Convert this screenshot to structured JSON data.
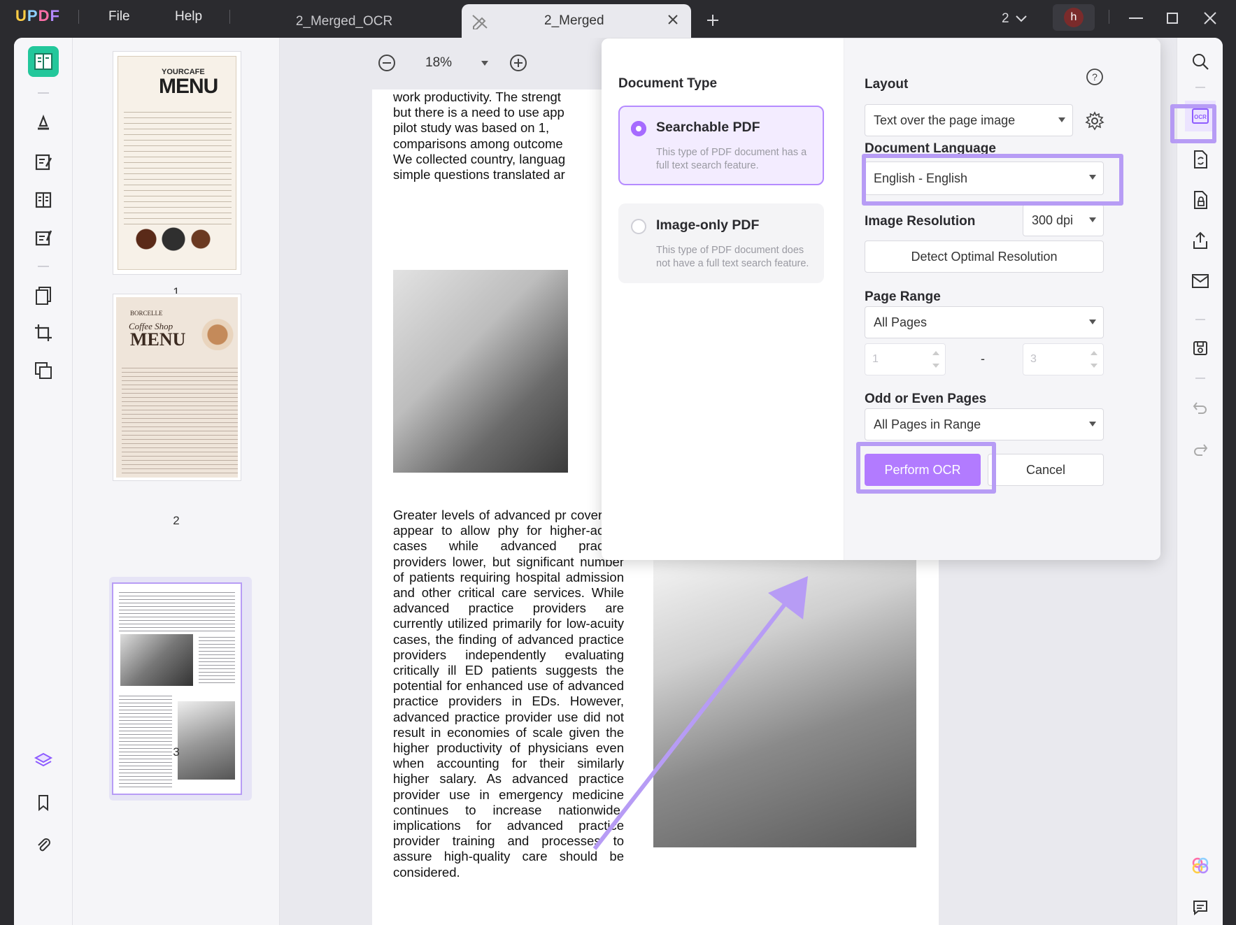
{
  "app": {
    "logo": "UPDF"
  },
  "menu": {
    "file": "File",
    "help": "Help"
  },
  "tabs": [
    {
      "label": "2_Merged_OCR"
    },
    {
      "label": "2_Merged"
    }
  ],
  "titlebar": {
    "page_count": "2",
    "user_initial": "h"
  },
  "zoom": {
    "value": "18%"
  },
  "thumbnails": [
    {
      "num": "1",
      "heading": "MENU",
      "sub": "YOURCAFE"
    },
    {
      "num": "2",
      "heading": "MENU",
      "sub": "Coffee Shop",
      "brand": "BORCELLE"
    },
    {
      "num": "3"
    }
  ],
  "page": {
    "para1": "work productivity. The strengt but there is a need to use app pilot study was based on 1, comparisons among outcome We collected country, languag simple questions translated ar",
    "para2": "Greater levels of advanced pr coverage appear to allow phy for higher-acuity cases while advanced practice providers lower, but significant number of patients requiring hospital admission and other critical care services. While advanced practice providers are currently utilized primarily for low-acuity cases, the finding of advanced practice providers independently evaluating critically ill ED patients suggests the potential for enhanced use of advanced practice providers in EDs. However, advanced practice provider use did not result in economies of scale given the higher productivity of physicians even when accounting for their similarly higher salary. As advanced practice provider use in emergency medicine continues to increase nationwide, implications for advanced practice provider training and processes to assure high-quality care should be considered."
  },
  "ocr_dialog": {
    "document_type_label": "Document Type",
    "options": [
      {
        "title": "Searchable PDF",
        "desc": "This type of PDF document has a full text search feature."
      },
      {
        "title": "Image-only PDF",
        "desc": "This type of PDF document does not have a full text search feature."
      }
    ],
    "layout_label": "Layout",
    "layout_value": "Text over the page image",
    "language_label": "Document Language",
    "language_value": "English - English",
    "resolution_label": "Image Resolution",
    "resolution_value": "300 dpi",
    "detect_button": "Detect Optimal Resolution",
    "page_range_label": "Page Range",
    "page_range_value": "All Pages",
    "range_from": "1",
    "range_dash": "-",
    "range_to": "3",
    "odd_even_label": "Odd or Even Pages",
    "odd_even_value": "All Pages in Range",
    "perform_button": "Perform OCR",
    "cancel_button": "Cancel"
  },
  "colors": {
    "accent": "#b27bff",
    "highlight": "#b79cf5",
    "rail_active": "#23c79b"
  }
}
